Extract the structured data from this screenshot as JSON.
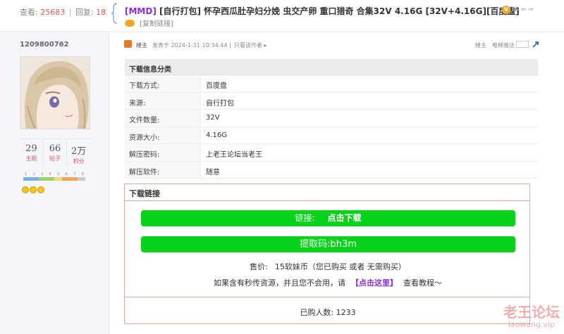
{
  "header": {
    "views_label": "查看:",
    "views": "25683",
    "separator": "|",
    "replies_label": "回复:",
    "replies": "18",
    "title_tag": "[MMD]",
    "title_text": " [自行打包] 怀孕西瓜肚孕妇分娩 虫交产卵 重口猎奇 合集32V 4.16G [32V+4.16G][百度盘]",
    "copy_link": "[复制链接]",
    "tool_icons": [
      "vip-badge-icon",
      "print-icon",
      "prev-icon",
      "next-icon"
    ]
  },
  "profile": {
    "uid": "1209800762",
    "counters": [
      {
        "value": "29",
        "label": "主题"
      },
      {
        "value": "66",
        "label": "帖子"
      },
      {
        "value": "2万",
        "label": "积分"
      }
    ],
    "level_numbers": [
      "1",
      "2",
      "3",
      "4",
      "5",
      "6",
      "7",
      "8"
    ],
    "level_colors": [
      "#7ab0e6",
      "#7ab0e6",
      "#9ed36a",
      "#9ed36a",
      "#f7d774",
      "#f5a35a",
      "#f5a35a",
      "#cccccc"
    ],
    "emoji_icons": [
      "smile-face-icon",
      "smile-face-icon",
      "smile-face-icon"
    ]
  },
  "post_meta": {
    "op_label": "楼主",
    "published": "发表于 2024-1-31 10:34:44",
    "separator": "|",
    "only_author": "只看该作者",
    "right_op": "楼主",
    "jump_label": "电梯直达"
  },
  "info_table": {
    "heading": "下载信息分类",
    "rows": [
      {
        "key": "下载方式:",
        "value": "百度盘"
      },
      {
        "key": "来源:",
        "value": "自行打包"
      },
      {
        "key": "文件数量:",
        "value": "32V"
      },
      {
        "key": "资源大小:",
        "value": "4.16G"
      },
      {
        "key": "解压密码:",
        "value": "上老王论坛当老王"
      },
      {
        "key": "解压软件:",
        "value": "随意"
      }
    ]
  },
  "download": {
    "heading": "下载链接",
    "link_label": "链接:",
    "link_action": "点击下载",
    "extract_code": "提取码:bh3m",
    "price_label": "售价:",
    "price_value": "15软妹币（您已购买 或者 无需购买）",
    "tutorial_before": "如果含有秒传资源，并且您不会用，请",
    "tutorial_link": "【点击这里】",
    "tutorial_after": "查看教程～",
    "buyers": "已购人数: 1233",
    "button_color": "#06d21a"
  },
  "watermark": {
    "title": "老王论坛",
    "domain": "laowang.vip"
  }
}
